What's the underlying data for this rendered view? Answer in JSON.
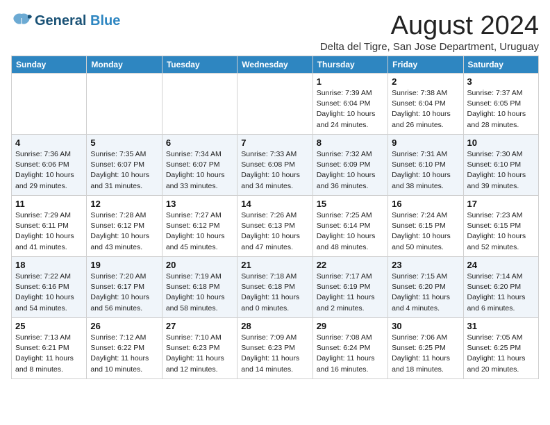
{
  "header": {
    "logo_line1": "General",
    "logo_line2": "Blue",
    "month_year": "August 2024",
    "location": "Delta del Tigre, San Jose Department, Uruguay"
  },
  "weekdays": [
    "Sunday",
    "Monday",
    "Tuesday",
    "Wednesday",
    "Thursday",
    "Friday",
    "Saturday"
  ],
  "weeks": [
    [
      {
        "day": "",
        "info": ""
      },
      {
        "day": "",
        "info": ""
      },
      {
        "day": "",
        "info": ""
      },
      {
        "day": "",
        "info": ""
      },
      {
        "day": "1",
        "info": "Sunrise: 7:39 AM\nSunset: 6:04 PM\nDaylight: 10 hours\nand 24 minutes."
      },
      {
        "day": "2",
        "info": "Sunrise: 7:38 AM\nSunset: 6:04 PM\nDaylight: 10 hours\nand 26 minutes."
      },
      {
        "day": "3",
        "info": "Sunrise: 7:37 AM\nSunset: 6:05 PM\nDaylight: 10 hours\nand 28 minutes."
      }
    ],
    [
      {
        "day": "4",
        "info": "Sunrise: 7:36 AM\nSunset: 6:06 PM\nDaylight: 10 hours\nand 29 minutes."
      },
      {
        "day": "5",
        "info": "Sunrise: 7:35 AM\nSunset: 6:07 PM\nDaylight: 10 hours\nand 31 minutes."
      },
      {
        "day": "6",
        "info": "Sunrise: 7:34 AM\nSunset: 6:07 PM\nDaylight: 10 hours\nand 33 minutes."
      },
      {
        "day": "7",
        "info": "Sunrise: 7:33 AM\nSunset: 6:08 PM\nDaylight: 10 hours\nand 34 minutes."
      },
      {
        "day": "8",
        "info": "Sunrise: 7:32 AM\nSunset: 6:09 PM\nDaylight: 10 hours\nand 36 minutes."
      },
      {
        "day": "9",
        "info": "Sunrise: 7:31 AM\nSunset: 6:10 PM\nDaylight: 10 hours\nand 38 minutes."
      },
      {
        "day": "10",
        "info": "Sunrise: 7:30 AM\nSunset: 6:10 PM\nDaylight: 10 hours\nand 39 minutes."
      }
    ],
    [
      {
        "day": "11",
        "info": "Sunrise: 7:29 AM\nSunset: 6:11 PM\nDaylight: 10 hours\nand 41 minutes."
      },
      {
        "day": "12",
        "info": "Sunrise: 7:28 AM\nSunset: 6:12 PM\nDaylight: 10 hours\nand 43 minutes."
      },
      {
        "day": "13",
        "info": "Sunrise: 7:27 AM\nSunset: 6:12 PM\nDaylight: 10 hours\nand 45 minutes."
      },
      {
        "day": "14",
        "info": "Sunrise: 7:26 AM\nSunset: 6:13 PM\nDaylight: 10 hours\nand 47 minutes."
      },
      {
        "day": "15",
        "info": "Sunrise: 7:25 AM\nSunset: 6:14 PM\nDaylight: 10 hours\nand 48 minutes."
      },
      {
        "day": "16",
        "info": "Sunrise: 7:24 AM\nSunset: 6:15 PM\nDaylight: 10 hours\nand 50 minutes."
      },
      {
        "day": "17",
        "info": "Sunrise: 7:23 AM\nSunset: 6:15 PM\nDaylight: 10 hours\nand 52 minutes."
      }
    ],
    [
      {
        "day": "18",
        "info": "Sunrise: 7:22 AM\nSunset: 6:16 PM\nDaylight: 10 hours\nand 54 minutes."
      },
      {
        "day": "19",
        "info": "Sunrise: 7:20 AM\nSunset: 6:17 PM\nDaylight: 10 hours\nand 56 minutes."
      },
      {
        "day": "20",
        "info": "Sunrise: 7:19 AM\nSunset: 6:18 PM\nDaylight: 10 hours\nand 58 minutes."
      },
      {
        "day": "21",
        "info": "Sunrise: 7:18 AM\nSunset: 6:18 PM\nDaylight: 11 hours\nand 0 minutes."
      },
      {
        "day": "22",
        "info": "Sunrise: 7:17 AM\nSunset: 6:19 PM\nDaylight: 11 hours\nand 2 minutes."
      },
      {
        "day": "23",
        "info": "Sunrise: 7:15 AM\nSunset: 6:20 PM\nDaylight: 11 hours\nand 4 minutes."
      },
      {
        "day": "24",
        "info": "Sunrise: 7:14 AM\nSunset: 6:20 PM\nDaylight: 11 hours\nand 6 minutes."
      }
    ],
    [
      {
        "day": "25",
        "info": "Sunrise: 7:13 AM\nSunset: 6:21 PM\nDaylight: 11 hours\nand 8 minutes."
      },
      {
        "day": "26",
        "info": "Sunrise: 7:12 AM\nSunset: 6:22 PM\nDaylight: 11 hours\nand 10 minutes."
      },
      {
        "day": "27",
        "info": "Sunrise: 7:10 AM\nSunset: 6:23 PM\nDaylight: 11 hours\nand 12 minutes."
      },
      {
        "day": "28",
        "info": "Sunrise: 7:09 AM\nSunset: 6:23 PM\nDaylight: 11 hours\nand 14 minutes."
      },
      {
        "day": "29",
        "info": "Sunrise: 7:08 AM\nSunset: 6:24 PM\nDaylight: 11 hours\nand 16 minutes."
      },
      {
        "day": "30",
        "info": "Sunrise: 7:06 AM\nSunset: 6:25 PM\nDaylight: 11 hours\nand 18 minutes."
      },
      {
        "day": "31",
        "info": "Sunrise: 7:05 AM\nSunset: 6:25 PM\nDaylight: 11 hours\nand 20 minutes."
      }
    ]
  ]
}
